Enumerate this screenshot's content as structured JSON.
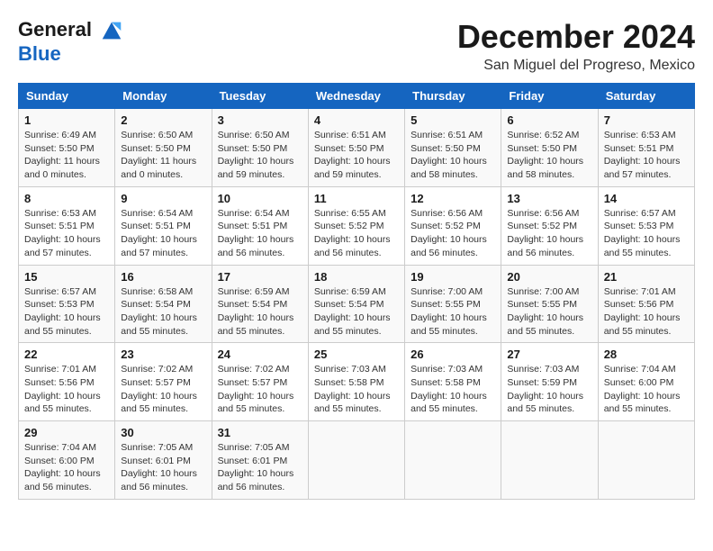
{
  "header": {
    "logo_line1": "General",
    "logo_line2": "Blue",
    "month": "December 2024",
    "location": "San Miguel del Progreso, Mexico"
  },
  "weekdays": [
    "Sunday",
    "Monday",
    "Tuesday",
    "Wednesday",
    "Thursday",
    "Friday",
    "Saturday"
  ],
  "weeks": [
    [
      {
        "day": "1",
        "sunrise": "6:49 AM",
        "sunset": "5:50 PM",
        "daylight": "11 hours and 0 minutes."
      },
      {
        "day": "2",
        "sunrise": "6:50 AM",
        "sunset": "5:50 PM",
        "daylight": "11 hours and 0 minutes."
      },
      {
        "day": "3",
        "sunrise": "6:50 AM",
        "sunset": "5:50 PM",
        "daylight": "10 hours and 59 minutes."
      },
      {
        "day": "4",
        "sunrise": "6:51 AM",
        "sunset": "5:50 PM",
        "daylight": "10 hours and 59 minutes."
      },
      {
        "day": "5",
        "sunrise": "6:51 AM",
        "sunset": "5:50 PM",
        "daylight": "10 hours and 58 minutes."
      },
      {
        "day": "6",
        "sunrise": "6:52 AM",
        "sunset": "5:50 PM",
        "daylight": "10 hours and 58 minutes."
      },
      {
        "day": "7",
        "sunrise": "6:53 AM",
        "sunset": "5:51 PM",
        "daylight": "10 hours and 57 minutes."
      }
    ],
    [
      {
        "day": "8",
        "sunrise": "6:53 AM",
        "sunset": "5:51 PM",
        "daylight": "10 hours and 57 minutes."
      },
      {
        "day": "9",
        "sunrise": "6:54 AM",
        "sunset": "5:51 PM",
        "daylight": "10 hours and 57 minutes."
      },
      {
        "day": "10",
        "sunrise": "6:54 AM",
        "sunset": "5:51 PM",
        "daylight": "10 hours and 56 minutes."
      },
      {
        "day": "11",
        "sunrise": "6:55 AM",
        "sunset": "5:52 PM",
        "daylight": "10 hours and 56 minutes."
      },
      {
        "day": "12",
        "sunrise": "6:56 AM",
        "sunset": "5:52 PM",
        "daylight": "10 hours and 56 minutes."
      },
      {
        "day": "13",
        "sunrise": "6:56 AM",
        "sunset": "5:52 PM",
        "daylight": "10 hours and 56 minutes."
      },
      {
        "day": "14",
        "sunrise": "6:57 AM",
        "sunset": "5:53 PM",
        "daylight": "10 hours and 55 minutes."
      }
    ],
    [
      {
        "day": "15",
        "sunrise": "6:57 AM",
        "sunset": "5:53 PM",
        "daylight": "10 hours and 55 minutes."
      },
      {
        "day": "16",
        "sunrise": "6:58 AM",
        "sunset": "5:54 PM",
        "daylight": "10 hours and 55 minutes."
      },
      {
        "day": "17",
        "sunrise": "6:59 AM",
        "sunset": "5:54 PM",
        "daylight": "10 hours and 55 minutes."
      },
      {
        "day": "18",
        "sunrise": "6:59 AM",
        "sunset": "5:54 PM",
        "daylight": "10 hours and 55 minutes."
      },
      {
        "day": "19",
        "sunrise": "7:00 AM",
        "sunset": "5:55 PM",
        "daylight": "10 hours and 55 minutes."
      },
      {
        "day": "20",
        "sunrise": "7:00 AM",
        "sunset": "5:55 PM",
        "daylight": "10 hours and 55 minutes."
      },
      {
        "day": "21",
        "sunrise": "7:01 AM",
        "sunset": "5:56 PM",
        "daylight": "10 hours and 55 minutes."
      }
    ],
    [
      {
        "day": "22",
        "sunrise": "7:01 AM",
        "sunset": "5:56 PM",
        "daylight": "10 hours and 55 minutes."
      },
      {
        "day": "23",
        "sunrise": "7:02 AM",
        "sunset": "5:57 PM",
        "daylight": "10 hours and 55 minutes."
      },
      {
        "day": "24",
        "sunrise": "7:02 AM",
        "sunset": "5:57 PM",
        "daylight": "10 hours and 55 minutes."
      },
      {
        "day": "25",
        "sunrise": "7:03 AM",
        "sunset": "5:58 PM",
        "daylight": "10 hours and 55 minutes."
      },
      {
        "day": "26",
        "sunrise": "7:03 AM",
        "sunset": "5:58 PM",
        "daylight": "10 hours and 55 minutes."
      },
      {
        "day": "27",
        "sunrise": "7:03 AM",
        "sunset": "5:59 PM",
        "daylight": "10 hours and 55 minutes."
      },
      {
        "day": "28",
        "sunrise": "7:04 AM",
        "sunset": "6:00 PM",
        "daylight": "10 hours and 55 minutes."
      }
    ],
    [
      {
        "day": "29",
        "sunrise": "7:04 AM",
        "sunset": "6:00 PM",
        "daylight": "10 hours and 56 minutes."
      },
      {
        "day": "30",
        "sunrise": "7:05 AM",
        "sunset": "6:01 PM",
        "daylight": "10 hours and 56 minutes."
      },
      {
        "day": "31",
        "sunrise": "7:05 AM",
        "sunset": "6:01 PM",
        "daylight": "10 hours and 56 minutes."
      },
      null,
      null,
      null,
      null
    ]
  ]
}
